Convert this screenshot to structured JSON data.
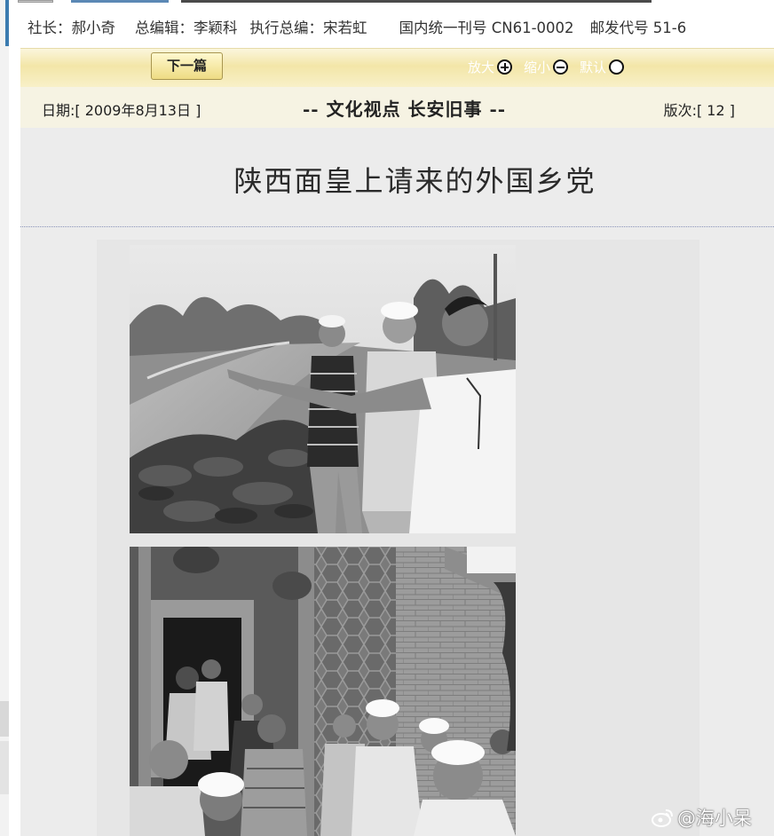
{
  "masthead": {
    "president": "社长：郝小奇",
    "chief_editor": "总编辑：李颖科",
    "exec_editor": "执行总编：宋若虹",
    "serial_number": "国内统一刊号 CN61-0002",
    "postal_code": "邮发代号 51-6"
  },
  "toolbar": {
    "next_label": "下一篇",
    "zoom_in_label": "放大",
    "zoom_out_label": "缩小",
    "default_label": "默认"
  },
  "infobar": {
    "date": "日期:[ 2009年8月13日 ]",
    "section": "-- 文化视点  长安旧事 --",
    "page": "版次:[ 12 ]"
  },
  "article": {
    "title": "陕西面皇上请来的外国乡党"
  },
  "watermark": {
    "text": "@海小呆"
  }
}
